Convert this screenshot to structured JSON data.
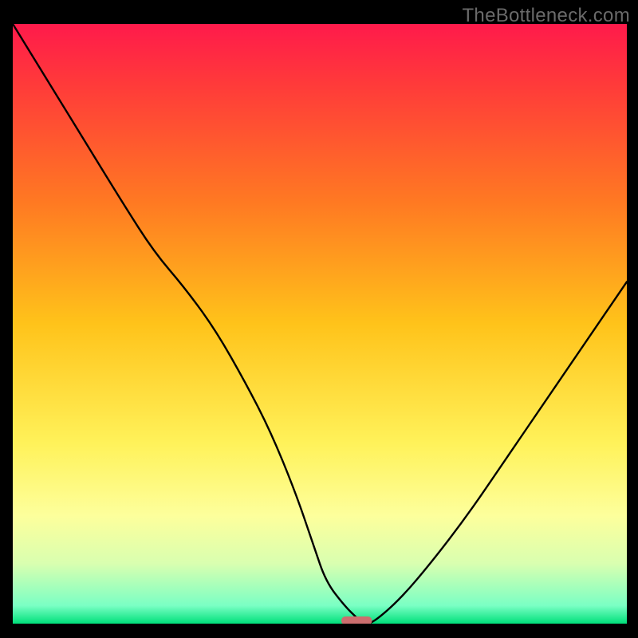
{
  "attribution": "TheBottleneck.com",
  "chart_data": {
    "type": "line",
    "title": "",
    "xlabel": "",
    "ylabel": "",
    "xlim": [
      0,
      100
    ],
    "ylim": [
      0,
      100
    ],
    "grid": false,
    "legend": false,
    "background": {
      "type": "vertical-gradient",
      "stops": [
        {
          "offset": 0.0,
          "color": "#ff1a4b"
        },
        {
          "offset": 0.1,
          "color": "#ff3a3a"
        },
        {
          "offset": 0.3,
          "color": "#ff7a22"
        },
        {
          "offset": 0.5,
          "color": "#ffc31a"
        },
        {
          "offset": 0.7,
          "color": "#fff25a"
        },
        {
          "offset": 0.82,
          "color": "#fdff9c"
        },
        {
          "offset": 0.9,
          "color": "#d9ffb0"
        },
        {
          "offset": 0.97,
          "color": "#7affc4"
        },
        {
          "offset": 1.0,
          "color": "#00e07a"
        }
      ]
    },
    "series": [
      {
        "name": "bottleneck-curve",
        "stroke": "#000000",
        "stroke_width": 2.4,
        "x": [
          0,
          6,
          12,
          18,
          23,
          28,
          33,
          38,
          42,
          46,
          49,
          51,
          54,
          56,
          57,
          58.5,
          63,
          68,
          74,
          80,
          86,
          92,
          100
        ],
        "y": [
          100,
          90,
          80,
          70,
          62,
          56,
          49,
          40,
          32,
          22,
          13,
          7,
          3,
          1,
          0,
          0,
          4,
          10,
          18,
          27,
          36,
          45,
          57
        ]
      }
    ],
    "marker": {
      "name": "optimal-range",
      "shape": "rounded-rect",
      "x": 56.0,
      "y": 0.5,
      "width": 5.0,
      "height": 1.4,
      "fill": "#cc6e6e"
    }
  },
  "colors": {
    "frame": "#000000",
    "attribution_text": "#6a6a6a"
  }
}
